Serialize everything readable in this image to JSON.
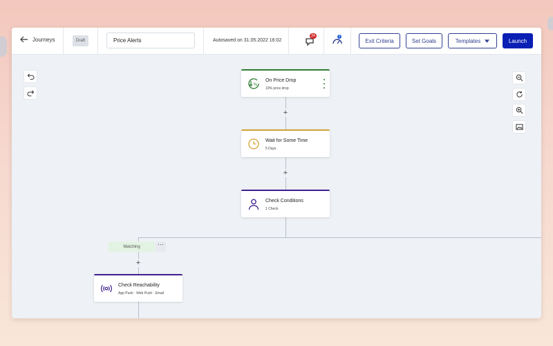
{
  "header": {
    "back_label": "Journeys",
    "status": "Draft",
    "journey_name": "Price Alerts",
    "autosaved": "Autosaved on 31.05.2022 16:02",
    "comments_count": "24",
    "activity_count": "1",
    "buttons": {
      "exit_criteria": "Exit Criteria",
      "set_goals": "Set Goals",
      "templates": "Templates",
      "launch": "Launch"
    }
  },
  "nodes": [
    {
      "title": "On Price Drop",
      "subtitle": "10% price drop",
      "color": "#2e7d32"
    },
    {
      "title": "Wait for Some Time",
      "subtitle": "5 Days",
      "color": "#d4a235"
    },
    {
      "title": "Check Conditions",
      "subtitle": "1 Check",
      "color": "#3f1f8f"
    },
    {
      "title": "Check Reachability",
      "subtitle": "App Push · Web Push · Email",
      "color": "#3f1f8f"
    }
  ],
  "branch": {
    "label": "Matching"
  },
  "colors": {
    "primary": "#0a1fb4",
    "trigger": "#2e7d32",
    "wait": "#d4a235",
    "condition": "#3f1f8f",
    "badge_red": "#d32f2f",
    "badge_blue": "#1e5bd8"
  }
}
